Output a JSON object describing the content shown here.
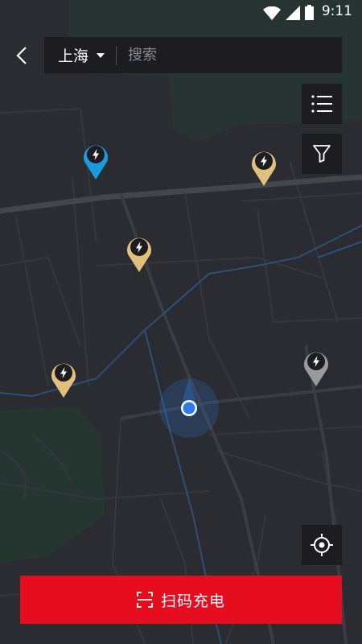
{
  "status_bar": {
    "time": "9:11",
    "icons": [
      "wifi-icon",
      "cellular-signal-icon",
      "battery-icon"
    ]
  },
  "header": {
    "city": "上海",
    "search_placeholder": "搜索"
  },
  "map": {
    "background_color": "#2b2c31",
    "road_color": "#3a3b40",
    "water_color": "#2f4f7a",
    "park_color": "#243a32",
    "stations": [
      {
        "status": "selected",
        "color": "#1a9be0"
      },
      {
        "status": "available",
        "color": "#e0c07a"
      },
      {
        "status": "available",
        "color": "#e0c07a"
      },
      {
        "status": "available",
        "color": "#e0c07a"
      },
      {
        "status": "offline",
        "color": "#9a9a9e"
      }
    ],
    "current_location_color": "#2f7bea"
  },
  "actions": {
    "list_icon": "list-icon",
    "filter_icon": "filter-icon",
    "locate_icon": "crosshair-icon",
    "scan_label": "扫码充电",
    "scan_icon": "scan-icon",
    "scan_color": "#e60d1f"
  }
}
